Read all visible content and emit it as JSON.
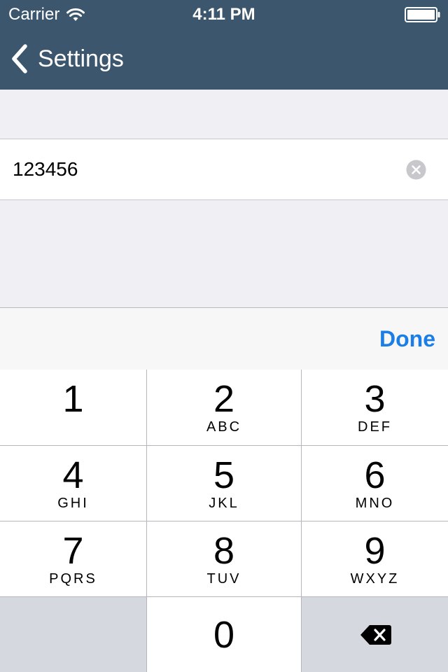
{
  "status_bar": {
    "carrier": "Carrier",
    "time": "4:11 PM",
    "wifi_icon": "wifi-icon",
    "battery_icon": "battery-icon"
  },
  "nav": {
    "back_label": "Settings",
    "back_icon": "chevron-left-icon",
    "bar_color": "#3c566d"
  },
  "field": {
    "value": "123456",
    "clear_icon": "clear-circle-icon"
  },
  "toolbar": {
    "done_label": "Done",
    "accent_color": "#1a7ee6"
  },
  "keypad": {
    "keys": [
      {
        "digit": "1",
        "letters": ""
      },
      {
        "digit": "2",
        "letters": "ABC"
      },
      {
        "digit": "3",
        "letters": "DEF"
      },
      {
        "digit": "4",
        "letters": "GHI"
      },
      {
        "digit": "5",
        "letters": "JKL"
      },
      {
        "digit": "6",
        "letters": "MNO"
      },
      {
        "digit": "7",
        "letters": "PQRS"
      },
      {
        "digit": "8",
        "letters": "TUV"
      },
      {
        "digit": "9",
        "letters": "WXYZ"
      },
      {
        "digit": "0",
        "letters": ""
      }
    ],
    "delete_icon": "backspace-icon"
  }
}
